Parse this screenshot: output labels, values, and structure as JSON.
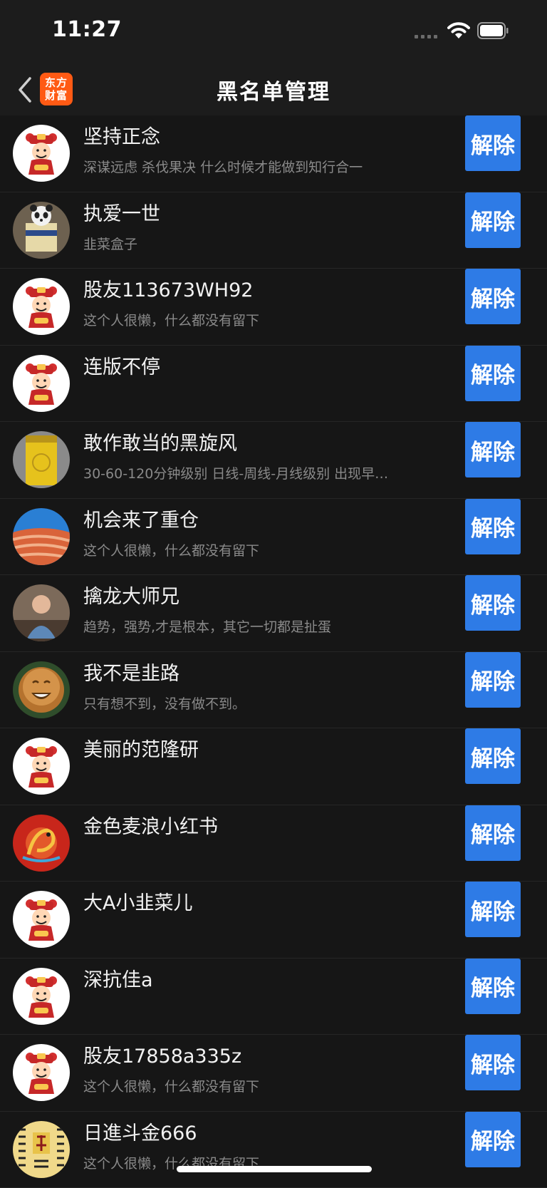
{
  "status_bar": {
    "time": "11:27"
  },
  "nav": {
    "title": "黑名单管理",
    "logo_line1": "东方",
    "logo_line2": "财富"
  },
  "colors": {
    "accent": "#2e7be6",
    "background": "#161616",
    "logo": "#ff5a14"
  },
  "unblock_label": "解除",
  "rows": [
    {
      "name": "坚持正念",
      "bio": "深谋远虑 杀伐果决 什么时候才能做到知行合一",
      "avatar": "caishen-avatar"
    },
    {
      "name": "执爱一世",
      "bio": "韭菜盒子",
      "avatar": "panda-avatar"
    },
    {
      "name": "股友113673WH92",
      "bio": "这个人很懒，什么都没有留下",
      "avatar": "caishen-avatar"
    },
    {
      "name": "连版不停",
      "bio": "",
      "avatar": "caishen-avatar"
    },
    {
      "name": "敢作敢当的黑旋风",
      "bio": "30-60-120分钟级别 日线-周线-月线级别 出现早…",
      "avatar": "yellow-pack-avatar"
    },
    {
      "name": "机会来了重仓",
      "bio": "这个人很懒，什么都没有留下",
      "avatar": "canyon-avatar"
    },
    {
      "name": "擒龙大师兄",
      "bio": "趋势，强势,才是根本，其它一切都是扯蛋",
      "avatar": "person-avatar"
    },
    {
      "name": "我不是韭路",
      "bio": "只有想不到，没有做不到。",
      "avatar": "buddha-avatar"
    },
    {
      "name": "美丽的范隆研",
      "bio": "",
      "avatar": "caishen-avatar"
    },
    {
      "name": "金色麦浪小红书",
      "bio": "",
      "avatar": "dragon-avatar"
    },
    {
      "name": "大A小韭菜儿",
      "bio": "",
      "avatar": "caishen-avatar"
    },
    {
      "name": "深抗佳a",
      "bio": "",
      "avatar": "caishen-avatar"
    },
    {
      "name": "股友17858a335z",
      "bio": "这个人很懒，什么都没有留下",
      "avatar": "caishen-avatar"
    },
    {
      "name": "日進斗金666",
      "bio": "这个人很懒，什么都没有留下",
      "avatar": "calligraphy-avatar"
    }
  ]
}
